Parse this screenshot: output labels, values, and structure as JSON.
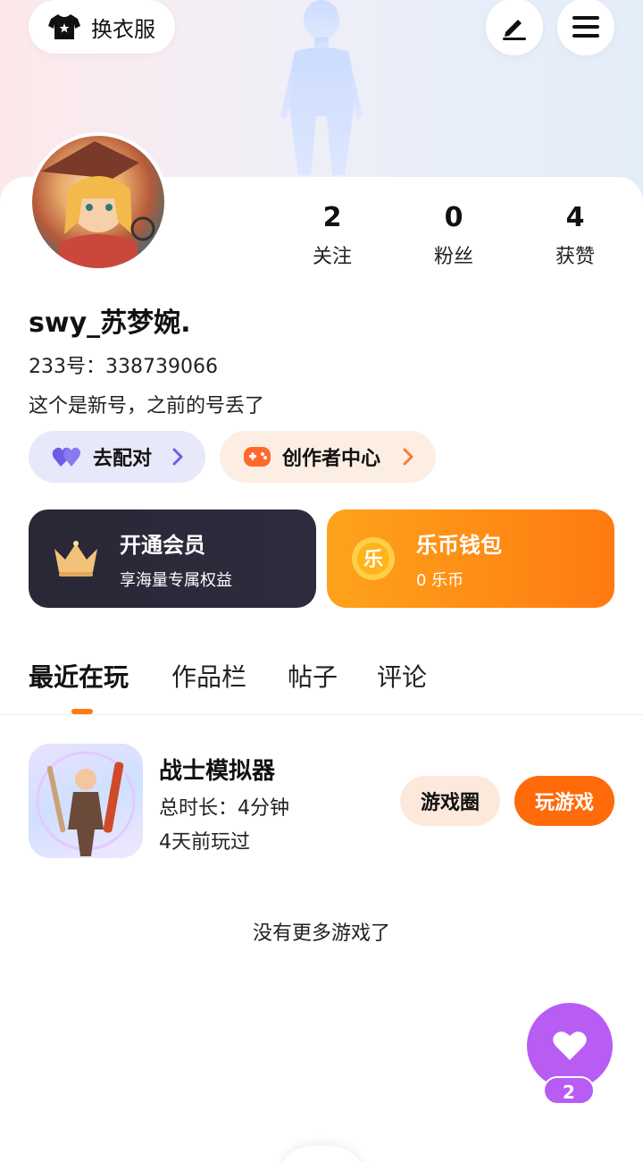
{
  "header": {
    "outfit_label": "换衣服"
  },
  "profile": {
    "stats": [
      {
        "value": "2",
        "label": "关注"
      },
      {
        "value": "0",
        "label": "粉丝"
      },
      {
        "value": "4",
        "label": "获赞"
      }
    ],
    "username": "swy_苏梦婉.",
    "uid": "233号：338739066",
    "bio": "这个是新号，之前的号丢了"
  },
  "chips": {
    "match_label": "去配对",
    "creator_label": "创作者中心"
  },
  "promos": {
    "vip_title": "开通会员",
    "vip_sub": "享海量专属权益",
    "wallet_title": "乐币钱包",
    "wallet_sub": "0 乐币",
    "wallet_coin_text": "乐"
  },
  "tabs": [
    "最近在玩",
    "作品栏",
    "帖子",
    "评论"
  ],
  "recent_game": {
    "title": "战士模拟器",
    "duration": "总时长：4分钟",
    "last_played": "4天前玩过",
    "circle_label": "游戏圈",
    "play_label": "玩游戏"
  },
  "footer": {
    "no_more": "没有更多游戏了"
  },
  "like_fab": {
    "count": "2"
  },
  "colors": {
    "accent": "#ff7a10",
    "vip_bg": "#2a2836",
    "wallet_bg": "#fea31c",
    "fab": "#b85cf4",
    "match_chip": "#e8e8fb",
    "creator_chip": "#fdeee4"
  }
}
